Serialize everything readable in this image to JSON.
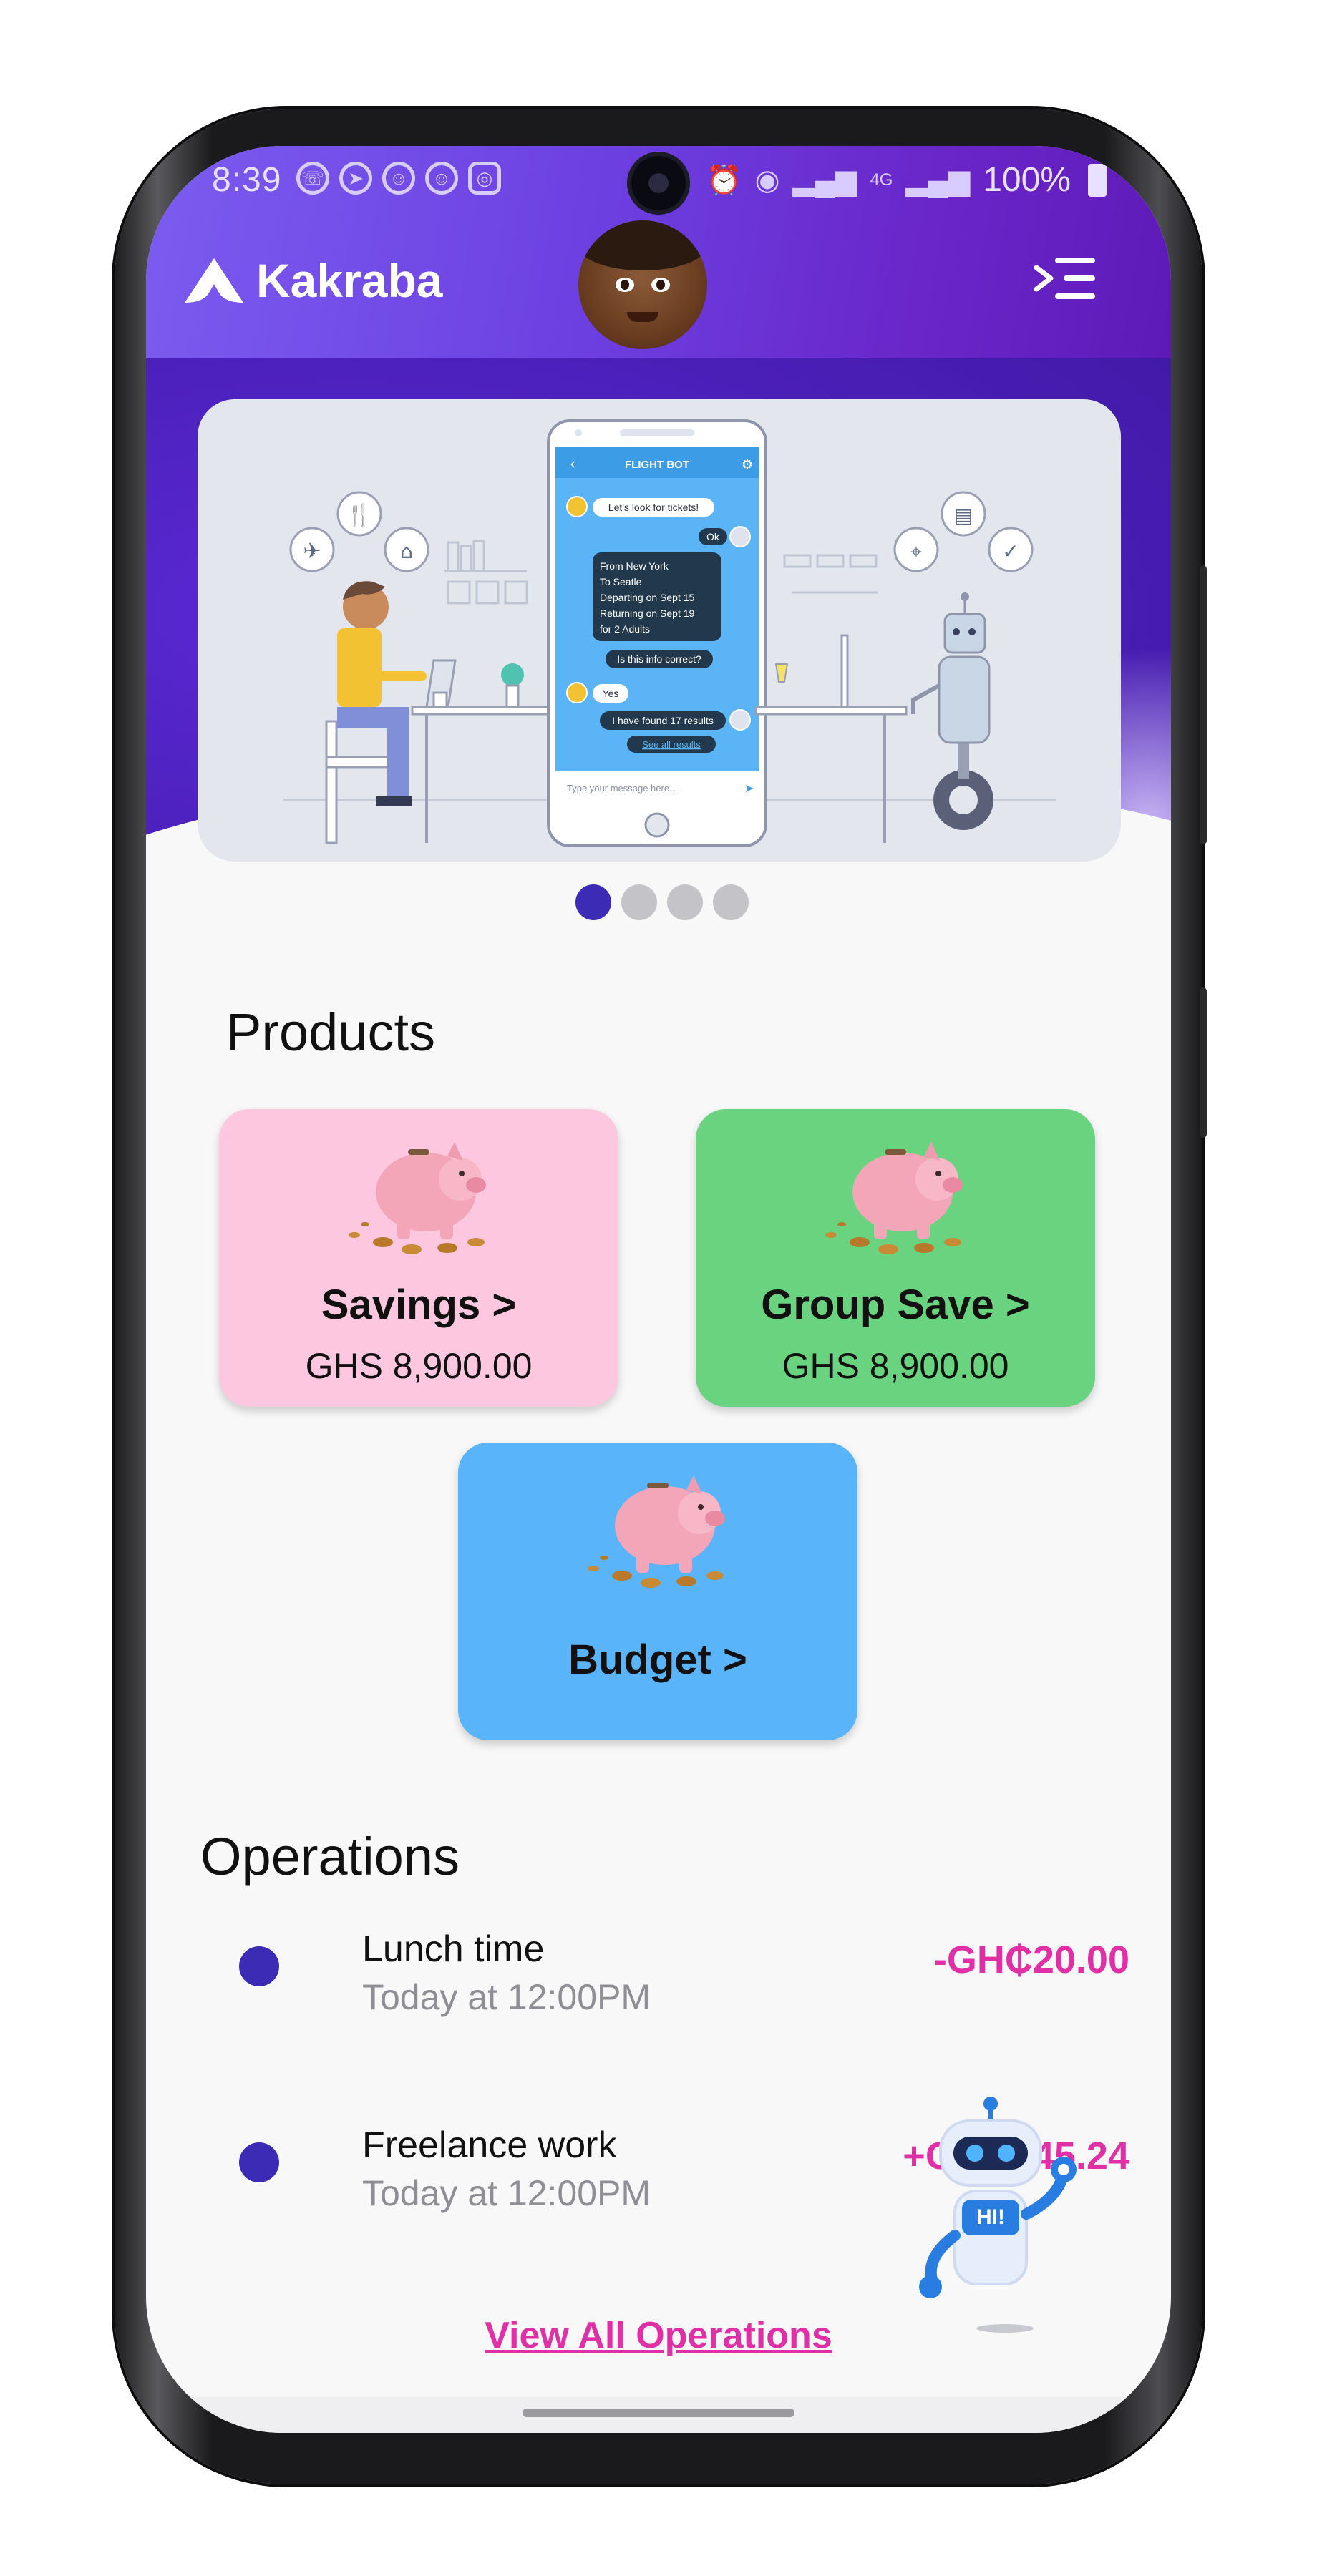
{
  "status_bar": {
    "time": "8:39",
    "battery": "100%",
    "network": "4G"
  },
  "header": {
    "app_name": "Kakraba"
  },
  "banner": {
    "chat_title": "FLIGHT BOT",
    "messages": [
      "Let's look for tickets!",
      "Ok",
      "From New York",
      "To Seatle",
      "Departing on Sept 15",
      "Returning on Sept 19",
      "for 2 Adults",
      "Is this info correct?",
      "Yes",
      "I have found 17 results",
      "See all results"
    ],
    "input_placeholder": "Type your message here...",
    "active_slide": 1,
    "slide_count": 4
  },
  "products": {
    "heading": "Products",
    "items": [
      {
        "title": "Savings >",
        "amount": "GHS 8,900.00",
        "color": "#fdc8df"
      },
      {
        "title": "Group Save >",
        "amount": "GHS 8,900.00",
        "color": "#6ad380"
      },
      {
        "title": "Budget >",
        "amount": "",
        "color": "#5ab4fa"
      }
    ]
  },
  "operations": {
    "heading": "Operations",
    "items": [
      {
        "name": "Lunch time",
        "when": "Today at 12:00PM",
        "amount": "-GH₵20.00"
      },
      {
        "name": "Freelance work",
        "when": "Today at 12:00PM",
        "amount": "+GH₵245.24"
      }
    ],
    "view_all": "View All Operations"
  },
  "assistant": {
    "bubble_text": "HI!"
  },
  "colors": {
    "header_purple": "#6c3fe0",
    "accent_indigo": "#3b2bb5",
    "amount_pink": "#e12fa5"
  }
}
